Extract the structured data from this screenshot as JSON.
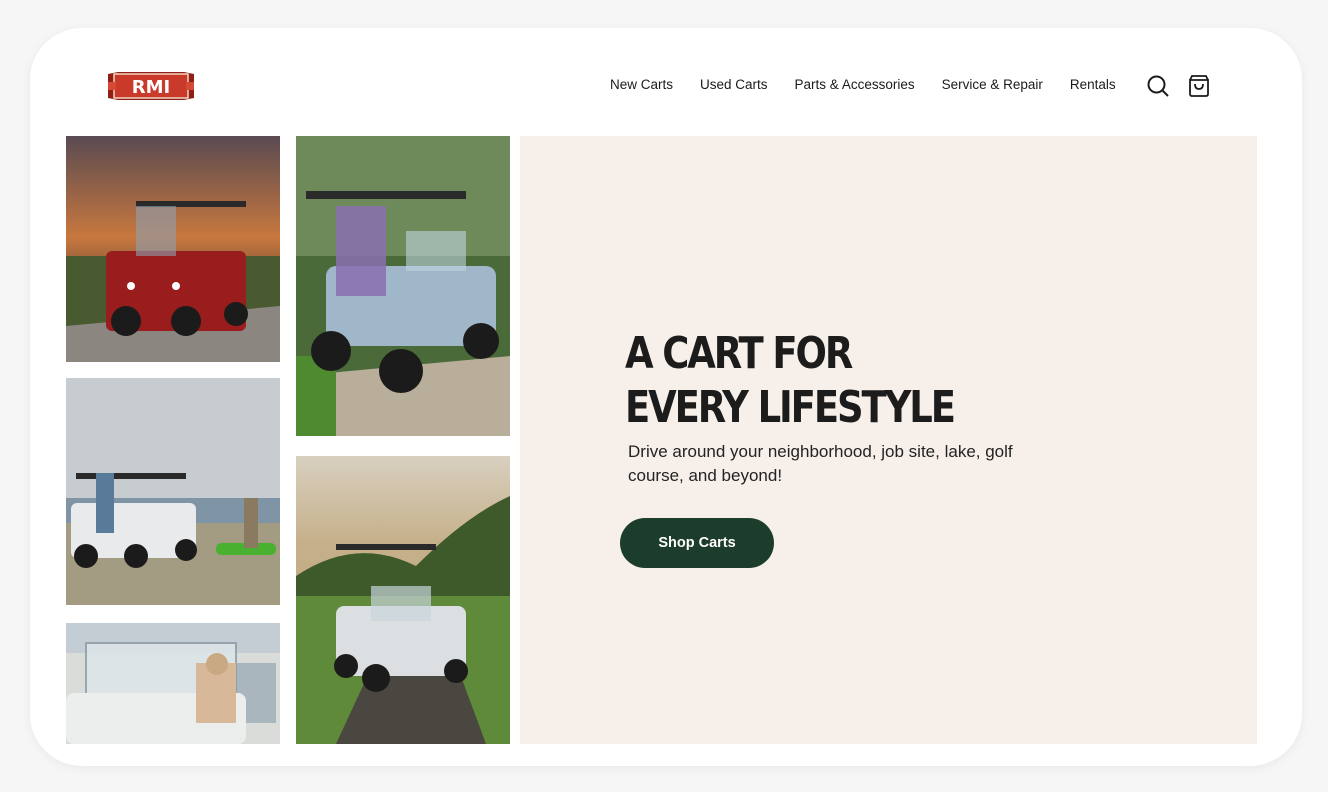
{
  "brand": {
    "logo_text": "RMI",
    "logo_color": "#c0392b"
  },
  "nav": {
    "items": [
      {
        "label": "New Carts"
      },
      {
        "label": "Used Carts"
      },
      {
        "label": "Parts & Accessories"
      },
      {
        "label": "Service & Repair"
      },
      {
        "label": "Rentals"
      }
    ],
    "search_icon": "search-icon",
    "cart_icon": "shopping-bag-icon"
  },
  "hero": {
    "title_line1": "A CART FOR",
    "title_line2": "EVERY LIFESTYLE",
    "subtitle": "Drive around your neighborhood, job site, lake, golf course, and beyond!",
    "cta_label": "Shop Carts",
    "background": "#f7f0ea",
    "cta_color": "#1d3d2c"
  }
}
